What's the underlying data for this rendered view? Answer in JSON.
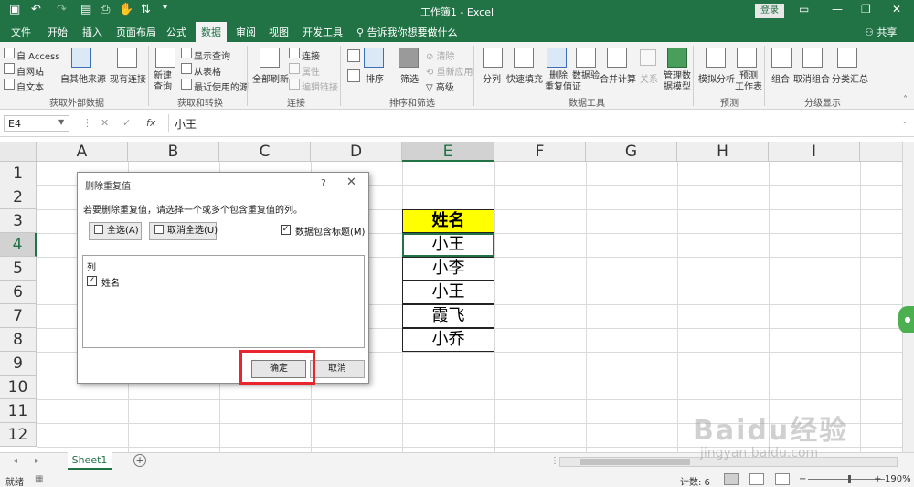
{
  "window": {
    "title": "工作簿1 - Excel",
    "login_label": "登录"
  },
  "tabs": [
    "文件",
    "开始",
    "插入",
    "页面布局",
    "公式",
    "数据",
    "审阅",
    "视图",
    "开发工具"
  ],
  "tell_me": "告诉我你想要做什么",
  "share": "共享",
  "ribbon": {
    "get_external": {
      "label": "获取外部数据",
      "items": [
        "自 Access",
        "自网站",
        "自文本",
        "自其他来源",
        "现有连接"
      ]
    },
    "get_transform": {
      "label": "获取和转换",
      "new_query": "新建\n查询",
      "items": [
        "显示查询",
        "从表格",
        "最近使用的源"
      ]
    },
    "connections": {
      "label": "连接",
      "refresh_all": "全部刷新",
      "items": [
        "连接",
        "属性",
        "编辑链接"
      ]
    },
    "sort_filter": {
      "label": "排序和筛选",
      "sort": "排序",
      "filter": "筛选",
      "items": [
        "清除",
        "重新应用",
        "高级"
      ]
    },
    "data_tools": {
      "label": "数据工具",
      "items": [
        "分列",
        "快速填充",
        "删除\n重复值",
        "数据验\n证",
        "合并计算",
        "关系",
        "管理数\n据模型"
      ]
    },
    "forecast": {
      "label": "预测",
      "items": [
        "模拟分析",
        "预测\n工作表"
      ]
    },
    "outline": {
      "label": "分级显示",
      "items": [
        "组合",
        "取消组合",
        "分类汇总"
      ]
    }
  },
  "formula_bar": {
    "name_box": "E4",
    "fx": "fx",
    "value": "小王"
  },
  "columns": [
    "A",
    "B",
    "C",
    "D",
    "E",
    "F",
    "G",
    "H",
    "I"
  ],
  "rows": [
    "1",
    "2",
    "3",
    "4",
    "5",
    "6",
    "7",
    "8",
    "9",
    "10",
    "11",
    "12"
  ],
  "cells": {
    "header": "姓名",
    "values": [
      "小王",
      "小李",
      "小王",
      "霞飞",
      "小乔"
    ]
  },
  "sheet_tab": "Sheet1",
  "status": {
    "ready": "就绪",
    "count": "计数: 6",
    "zoom": "190%"
  },
  "dialog": {
    "title": "删除重复值",
    "help": "?",
    "description": "若要删除重复值，请选择一个或多个包含重复值的列。",
    "select_all": "全选(A)",
    "unselect_all": "取消全选(U)",
    "has_headers_label": "数据包含标题(M)",
    "has_headers_checked": true,
    "list_header": "列",
    "columns": [
      {
        "label": "姓名",
        "checked": true
      }
    ],
    "ok": "确定",
    "cancel": "取消"
  },
  "watermark": {
    "text": "Baidu经验",
    "url": "jingyan.baidu.com"
  },
  "colors": {
    "brand": "#217346",
    "header_fill": "#ffff00",
    "highlight": "#e8262d"
  }
}
